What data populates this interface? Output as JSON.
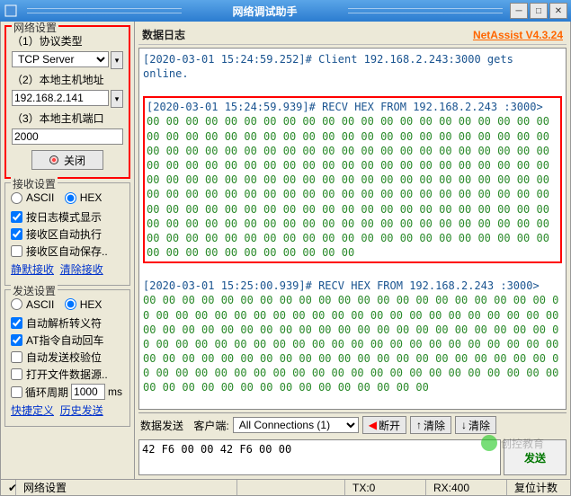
{
  "title": "网络调试助手",
  "version": "NetAssist V4.3.24",
  "network": {
    "title": "网络设置",
    "label_protocol": "（1）协议类型",
    "protocol_value": "TCP Server",
    "label_host": "（2）本地主机地址",
    "host_value": "192.168.2.141",
    "label_port": "（3）本地主机端口",
    "port_value": "2000",
    "close_btn": "关闭"
  },
  "recv": {
    "title": "接收设置",
    "ascii": "ASCII",
    "hex": "HEX",
    "by_log": "按日志模式显示",
    "auto_exec": "接收区自动执行",
    "auto_save": "接收区自动保存..",
    "silent": "静默接收",
    "clear": "清除接收"
  },
  "send": {
    "title": "发送设置",
    "ascii": "ASCII",
    "hex": "HEX",
    "parse_escape": "自动解析转义符",
    "at_cr": "AT指令自动回车",
    "auto_checksum": "自动发送校验位",
    "open_file": "打开文件数据源..",
    "loop_label": "循环周期",
    "loop_value": "1000",
    "loop_unit": "ms",
    "quick_def": "快捷定义",
    "history": "历史发送"
  },
  "log": {
    "title": "数据日志",
    "client_line": "[2020-03-01 15:24:59.252]# Client 192.168.2.243:3000 gets online.",
    "block1_header": "[2020-03-01 15:24:59.939]# RECV HEX FROM 192.168.2.243 :3000>",
    "block1_data": "00 00 00 00 00 00 00 00 00 00 00 00 00 00 00 00 00 00 00 00 00 00 00 00 00 00 00 00 00 00 00 00 00 00 00 00 00 00 00 00 00 00 00 00 00 00 00 00 00 00 00 00 00 00 00 00 00 00 00 00 00 00 00 00 00 00 00 00 00 00 00 00 00 00 00 00 00 00 00 00 00 00 00 00 00 00 00 00 00 00 00 00 00 00 00 00 00 00 00 00 00 00 00 00 00 00 00 00 00 00 00 00 00 00 00 00 00 00 00 00 00 00 00 00 00 00 00 00 00 00 00 00 00 00 00 00 00 00 00 00 00 00 00 00 00 00 00 00 00 00 00 00 00 00 00 00 00 00 00 00 00 00 00 00 00 00 00 00 00 00 00 00 00 00 00 00 00 00 00 00 00 00 00 00 00 00 00 00 00 00 00 00 00 00 00 00 00 00 00 00",
    "block2_header": "[2020-03-01 15:25:00.939]# RECV HEX FROM 192.168.2.243 :3000>",
    "block2_data": "00 00 00 00 00 00 00 00 00 00 00 00 00 00 00 00 00 00 00 00 00 00 00 00 00 00 00 00 00 00 00 00 00 00 00 00 00 00 00 00 00 00 00 00 00 00 00 00 00 00 00 00 00 00 00 00 00 00 00 00 00 00 00 00 00 00 00 00 00 00 00 00 00 00 00 00 00 00 00 00 00 00 00 00 00 00 00 00 00 00 00 00 00 00 00 00 00 00 00 00 00 00 00 00 00 00 00 00 00 00 00 00 00 00 00 00 00 00 00 00 00 00 00 00 00 00 00 00 00 00 00 00 00 00 00 00 00 00 00 00 00 00 00 00"
  },
  "sendbar": {
    "label_send": "数据发送",
    "label_client": "客户端:",
    "conn_value": "All Connections (1)",
    "disconnect": "断开",
    "clear_up": "清除",
    "clear_down": "清除",
    "input_value": "42 F6 00 00 42 F6 00 00",
    "send_btn": "发送"
  },
  "status": {
    "net_settings": "网络设置",
    "tx": "TX:0",
    "rx": "RX:400",
    "reset": "复位计数"
  },
  "watermark": "创控教育"
}
